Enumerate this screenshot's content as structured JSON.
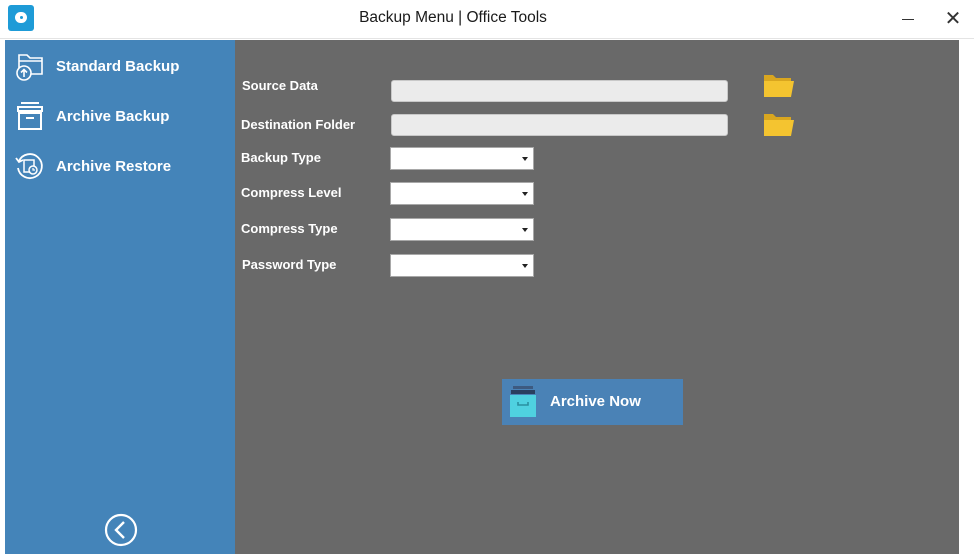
{
  "window": {
    "title": "Backup Menu | Office Tools",
    "minimize_glyph": "",
    "close_glyph": "✕"
  },
  "sidebar": {
    "items": [
      {
        "label": "Standard Backup",
        "icon": "folder-upload-icon"
      },
      {
        "label": "Archive Backup",
        "icon": "archive-box-icon"
      },
      {
        "label": "Archive Restore",
        "icon": "restore-clock-icon"
      }
    ],
    "back_icon": "chevron-left-circle-icon"
  },
  "form": {
    "source_data": {
      "label": "Source Data",
      "value": ""
    },
    "destination_folder": {
      "label": "Destination Folder",
      "value": ""
    },
    "backup_type": {
      "label": "Backup Type",
      "value": ""
    },
    "compress_level": {
      "label": "Compress Level",
      "value": ""
    },
    "compress_type": {
      "label": "Compress Type",
      "value": ""
    },
    "password_type": {
      "label": "Password Type",
      "value": ""
    },
    "folder_icon": "folder-open-icon"
  },
  "actions": {
    "archive_now_label": "Archive Now",
    "archive_now_icon": "archive-box-icon"
  },
  "colors": {
    "sidebar_bg": "#4484b9",
    "main_bg": "#696969",
    "button_bg": "#4a82b6",
    "folder_yellow": "#f4c430",
    "app_icon_bg": "#1e9bd7"
  }
}
